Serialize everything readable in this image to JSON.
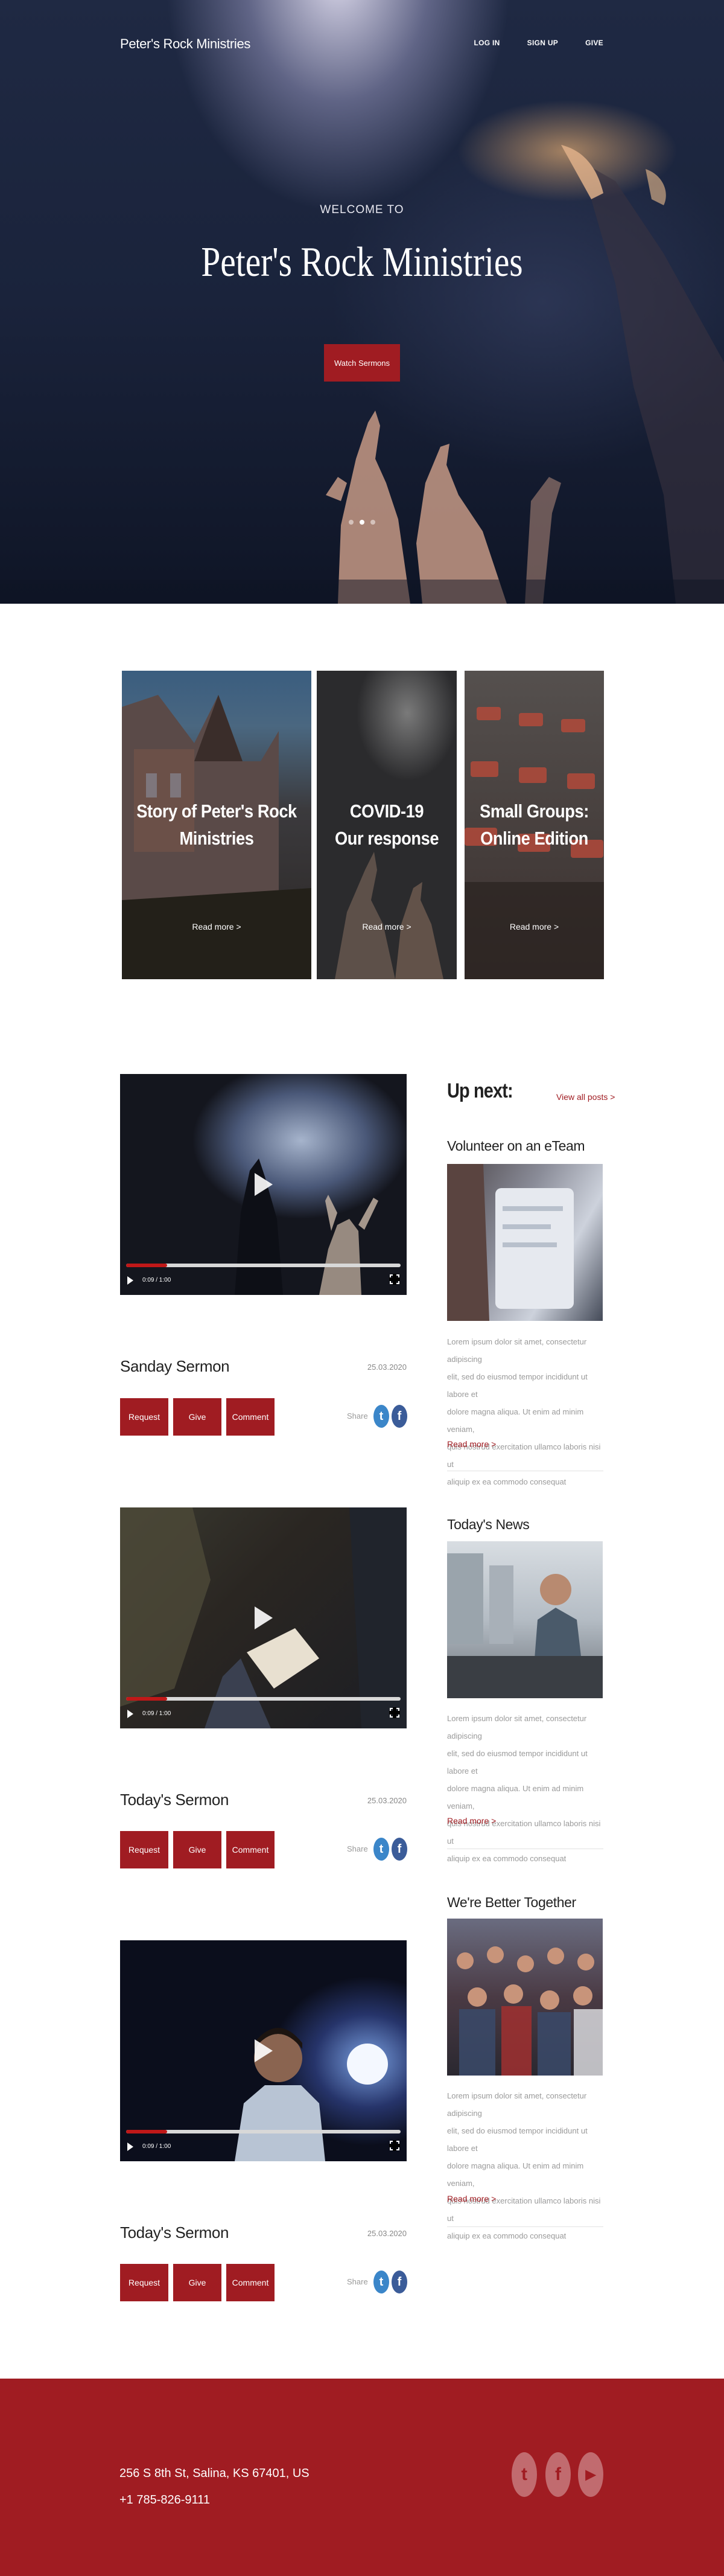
{
  "header": {
    "brand": "Peter's Rock Ministries",
    "nav": [
      "LOG IN",
      "SIGN UP",
      "GIVE"
    ]
  },
  "hero": {
    "kicker": "WELCOME TO",
    "title": "Peter's Rock Ministries",
    "cta": "Watch Sermons",
    "slide_count": 3,
    "active_slide": 2
  },
  "features": [
    {
      "title_line1": "Story of Peter's Rock",
      "title_line2": "Ministries",
      "link": "Read more >"
    },
    {
      "title_line1": "COVID-19",
      "title_line2": "Our response",
      "link": "Read more >"
    },
    {
      "title_line1": "Small Groups:",
      "title_line2": "Online Edition",
      "link": "Read more >"
    }
  ],
  "sermons": [
    {
      "title": "Sanday Sermon",
      "date": "25.03.2020",
      "time": "0:09 / 1:00",
      "progress": 0.15
    },
    {
      "title": "Today's Sermon",
      "date": "25.03.2020",
      "time": "0:09 / 1:00",
      "progress": 0.15
    },
    {
      "title": "Today's Sermon",
      "date": "25.03.2020",
      "time": "0:09 / 1:00",
      "progress": 0.15
    }
  ],
  "sermon_actions": {
    "request": "Request",
    "give": "Give",
    "comment": "Comment",
    "share": "Share"
  },
  "sidebar": {
    "heading": "Up next:",
    "view_all": "View all posts >",
    "posts": [
      {
        "title": "Volunteer on an eTeam",
        "link": "Read more >",
        "body": [
          "Lorem ipsum dolor sit amet, consectetur adipiscing",
          "elit, sed do eiusmod tempor incididunt ut labore et",
          "dolore magna aliqua. Ut enim ad minim veniam,",
          "quis nostrud exercitation ullamco laboris nisi ut",
          "aliquip ex ea commodo consequat"
        ]
      },
      {
        "title": "Today's News",
        "link": "Read more >",
        "body": [
          "Lorem ipsum dolor sit amet, consectetur adipiscing",
          "elit, sed do eiusmod tempor incididunt ut labore et",
          "dolore magna aliqua. Ut enim ad minim veniam,",
          "quis nostrud exercitation ullamco laboris nisi ut",
          "aliquip ex ea commodo consequat"
        ]
      },
      {
        "title": "We're Better Together",
        "link": "Read more >",
        "body": [
          "Lorem ipsum dolor sit amet, consectetur adipiscing",
          "elit, sed do eiusmod tempor incididunt ut labore et",
          "dolore magna aliqua. Ut enim ad minim veniam,",
          "quis nostrud exercitation ullamco laboris nisi ut",
          "aliquip ex ea commodo consequat"
        ]
      }
    ]
  },
  "footer": {
    "address": "256 S 8th St, Salina, KS 67401, US",
    "phone": "+1 785-826-9111",
    "social_icons": [
      "twitter-icon",
      "facebook-icon",
      "youtube-icon"
    ]
  },
  "colors": {
    "accent": "#a01c22",
    "twitter": "#3b86c9",
    "facebook": "#3b5c99"
  }
}
